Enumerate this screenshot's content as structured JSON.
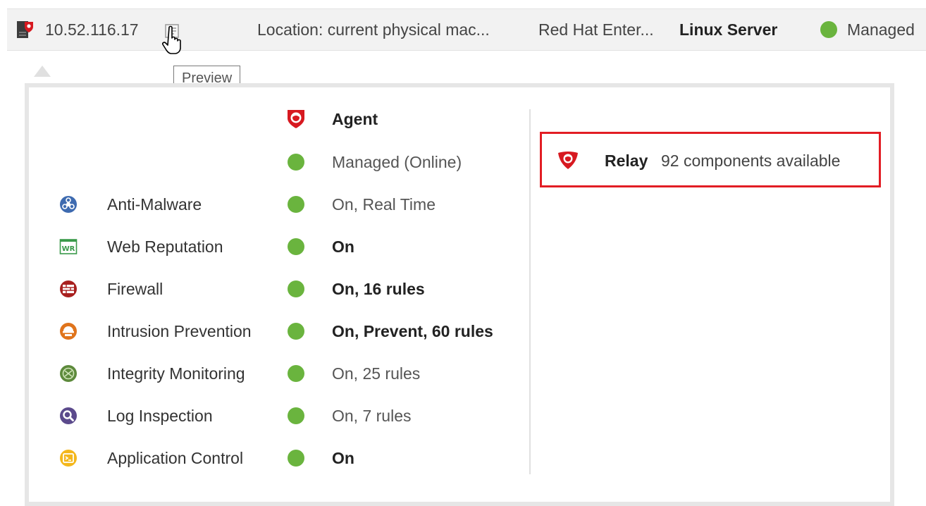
{
  "computer_row": {
    "ip": "10.52.116.17",
    "location": "Location: current physical mac...",
    "os": "Red Hat Enter...",
    "platform": "Linux Server",
    "status": "Managed"
  },
  "tooltip": "Preview",
  "popup": {
    "agent": {
      "label": "Agent",
      "status": "Managed (Online)"
    },
    "features": [
      {
        "name": "Anti-Malware",
        "status": "On, Real Time",
        "icon": "anti-malware-icon"
      },
      {
        "name": "Web Reputation",
        "status": "On",
        "icon": "web-reputation-icon"
      },
      {
        "name": "Firewall",
        "status": "On, 16 rules",
        "icon": "firewall-icon"
      },
      {
        "name": "Intrusion Prevention",
        "status": "On, Prevent, 60 rules",
        "icon": "intrusion-prevention-icon"
      },
      {
        "name": "Integrity Monitoring",
        "status": "On, 25 rules",
        "icon": "integrity-monitoring-icon"
      },
      {
        "name": "Log Inspection",
        "status": "On, 7 rules",
        "icon": "log-inspection-icon"
      },
      {
        "name": "Application Control",
        "status": "On",
        "icon": "application-control-icon"
      }
    ],
    "relay": {
      "label": "Relay",
      "info": "92 components available"
    }
  },
  "colors": {
    "status_green": "#6ab43e",
    "highlight_red": "#e21d24",
    "trend_red": "#d71920"
  }
}
